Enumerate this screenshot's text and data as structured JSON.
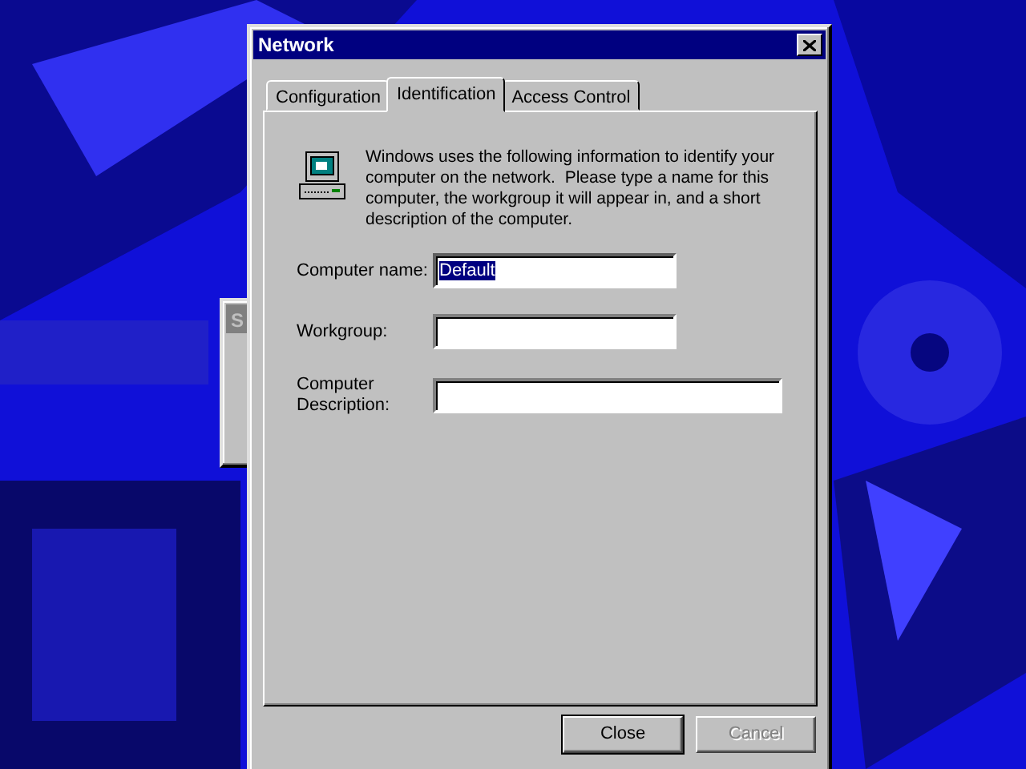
{
  "background_window": {
    "title": "S"
  },
  "window": {
    "title": "Network"
  },
  "tabs": [
    {
      "label": "Configuration",
      "selected": false
    },
    {
      "label": "Identification",
      "selected": true
    },
    {
      "label": "Access Control",
      "selected": false
    }
  ],
  "intro": "Windows uses the following information to identify your computer on the network.  Please type a name for this computer, the workgroup it will appear in, and a short description of the computer.",
  "fields": [
    {
      "label": "Computer name:",
      "value": "Default",
      "selected": true,
      "wide": false
    },
    {
      "label": "Workgroup:",
      "selected": false,
      "wide": false
    },
    {
      "label": "Computer Description:",
      "selected": false,
      "wide": true
    }
  ],
  "buttons": [
    {
      "label": "Close",
      "default": true,
      "disabled": false
    },
    {
      "label": "Cancel",
      "default": false,
      "disabled": true
    }
  ]
}
